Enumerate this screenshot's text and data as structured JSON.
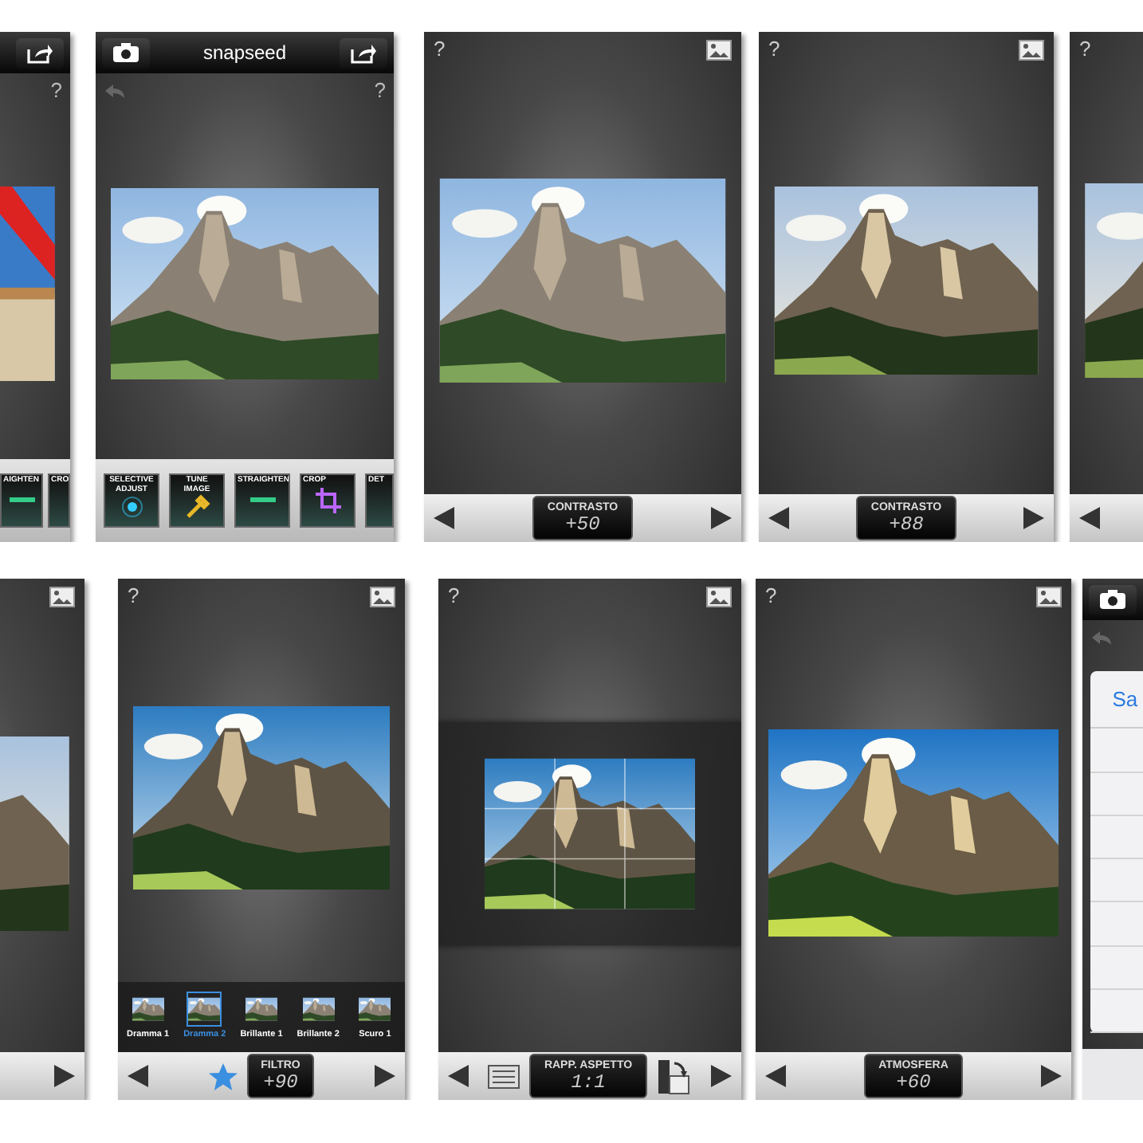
{
  "rows": [
    {
      "screens": [
        {
          "kind": "main",
          "help": "?",
          "photo": {
            "kind": "sample"
          },
          "bottom": {
            "kind": "tools",
            "tools": [
              {
                "label": "AIGHTEN",
                "kind": "straighten"
              },
              {
                "label": "CRO",
                "kind": "crop"
              }
            ]
          }
        },
        {
          "kind": "main",
          "title": "snapseed",
          "help": "?",
          "photo": {
            "kind": "natural"
          },
          "bottom": {
            "kind": "tools",
            "tools": [
              {
                "label": "SELECTIVE ADJUST",
                "kind": "selective"
              },
              {
                "label": "TUNE IMAGE",
                "kind": "tune"
              },
              {
                "label": "STRAIGHTEN",
                "kind": "straighten"
              },
              {
                "label": "CROP",
                "kind": "crop"
              },
              {
                "label": "DET",
                "kind": "detail"
              }
            ]
          }
        },
        {
          "kind": "edit",
          "help": "?",
          "photo": {
            "kind": "natural"
          },
          "bottom": {
            "kind": "slider",
            "label": "CONTRASTO",
            "value": "+50"
          }
        },
        {
          "kind": "edit",
          "help": "?",
          "photo": {
            "kind": "contrast"
          },
          "bottom": {
            "kind": "slider",
            "label": "CONTRASTO",
            "value": "+88"
          }
        },
        {
          "kind": "edit",
          "help": "?",
          "photo": {
            "kind": "contrast"
          },
          "bottom": {
            "kind": "slider"
          }
        }
      ]
    },
    {
      "screens": [
        {
          "kind": "edit",
          "photo": {
            "kind": "contrast"
          },
          "bottom": {
            "kind": "slider"
          }
        },
        {
          "kind": "edit",
          "help": "?",
          "photo": {
            "kind": "drama"
          },
          "bottom": {
            "kind": "filter",
            "label": "FILTRO",
            "value": "+90",
            "filters": [
              {
                "label": "Dramma 1",
                "selected": false
              },
              {
                "label": "Dramma 2",
                "selected": true
              },
              {
                "label": "Brillante 1",
                "selected": false
              },
              {
                "label": "Brillante 2",
                "selected": false
              },
              {
                "label": "Scuro 1",
                "selected": false
              }
            ]
          }
        },
        {
          "kind": "edit",
          "help": "?",
          "photo": {
            "kind": "crop"
          },
          "bottom": {
            "kind": "crop",
            "label": "RAPP. ASPETTO",
            "value": "1:1"
          }
        },
        {
          "kind": "edit",
          "help": "?",
          "photo": {
            "kind": "vivid"
          },
          "bottom": {
            "kind": "slider",
            "label": "ATMOSFERA",
            "value": "+60"
          }
        },
        {
          "kind": "main",
          "dialog": {
            "title": "Sa"
          },
          "bottom": {
            "kind": "none"
          }
        }
      ]
    }
  ]
}
